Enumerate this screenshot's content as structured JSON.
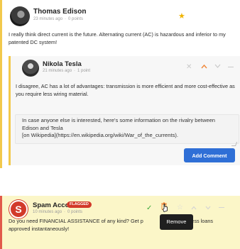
{
  "post": {
    "author": "Thomas Edison",
    "time": "23 minutes ago",
    "points": "0 points",
    "text": "I really think direct current is the future. Alternating current (AC) is hazardous and inferior to my patented DC system!"
  },
  "reply": {
    "author": "Nikola Tesla",
    "time": "21 minutes ago",
    "points": "1 point",
    "text": "I disagree, AC has a lot of advantages: transmission is more efficient and more cost-effective as you require less wiring material.",
    "comment_value": "In case anyone else is interested, here's some information on the rivalry between Edison and Tesla\n[on Wikipedia](https://en.wikipedia.org/wiki/War_of_the_currents).",
    "add_comment_label": "Add Comment"
  },
  "spam": {
    "author": "Spam Account",
    "badge": "FLAGGED",
    "avatar_letter": "S",
    "time": "10 minutes ago",
    "points": "0 points",
    "text_line1": "Do you need FINANCIAL ASSISTANCE of any kind? Get p",
    "text_line1_end": "business loans",
    "text_line2": "approved instantaneously!",
    "tooltip": "Remove"
  },
  "colors": {
    "accent_yellow": "#f2c94c",
    "accent_orange": "#f0883a",
    "button_blue": "#2f6fd6",
    "spam_red": "#d23a2a",
    "spam_bg": "#fbf6c8",
    "approve_green": "#3aa83a"
  },
  "icons": [
    "star-icon",
    "close-icon",
    "chevron-up-icon",
    "chevron-down-icon",
    "minus-icon",
    "check-icon",
    "trash-icon",
    "star-outline-icon",
    "mouse-cursor-icon"
  ]
}
